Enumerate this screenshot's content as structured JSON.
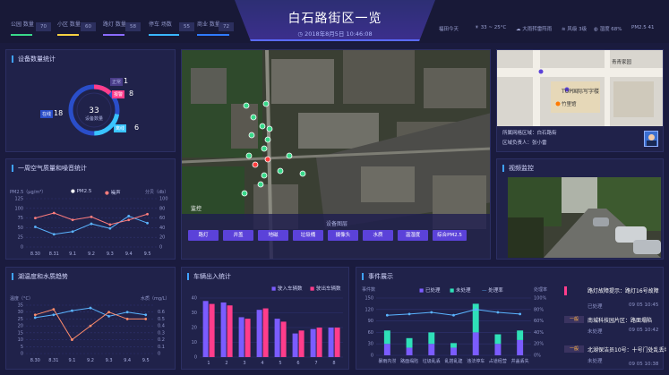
{
  "header": {
    "title": "白石路街区一览",
    "datetime": "2018年8月5日 10:46:08",
    "stats": [
      {
        "label": "公园\n数量",
        "value": "70",
        "color": "#39d98a"
      },
      {
        "label": "小区\n数量",
        "value": "60",
        "color": "#f5d142"
      },
      {
        "label": "路灯\n数量",
        "value": "58",
        "color": "#8a6bff"
      },
      {
        "label": "停车\n场数",
        "value": "55",
        "color": "#39b6ff"
      },
      {
        "label": "商业\n数量",
        "value": "72",
        "color": "#2f7bff"
      }
    ],
    "weather": {
      "label": "福田今天",
      "temp": "33 ~ 25°C",
      "condition": "大雨转雷阵雨",
      "wind": "风级 3级",
      "humidity": "湿度 68%",
      "pm": "PM2.5 41"
    }
  },
  "device_panel": {
    "title": "设备数量统计",
    "center_value": "33",
    "center_label": "设备数量",
    "labels": [
      {
        "text": "正常",
        "value": "1"
      },
      {
        "text": "报警",
        "value": "8"
      },
      {
        "text": "在线",
        "value": "18"
      },
      {
        "text": "离线",
        "value": "6"
      }
    ]
  },
  "air_panel": {
    "title": "一周空气质量和噪音统计",
    "left_unit": "PM2.5（μg/m³）",
    "right_unit": "分贝（db）",
    "legend": [
      "PM2.5",
      "噪声"
    ],
    "chart_data": {
      "type": "line",
      "categories": [
        "8.30",
        "8.31",
        "9.1",
        "9.2",
        "9.3",
        "9.4",
        "9.5"
      ],
      "series": [
        {
          "name": "PM2.5",
          "values": [
            52,
            33,
            40,
            60,
            48,
            80,
            62
          ],
          "color": "#5ab4ff"
        },
        {
          "name": "噪声",
          "values": [
            75,
            88,
            70,
            78,
            58,
            70,
            85
          ],
          "color": "#ff7d7d"
        }
      ],
      "ylim": [
        0,
        125
      ],
      "yticks": [
        0,
        25,
        50,
        75,
        100,
        125
      ],
      "y2ticks": [
        0,
        20,
        40,
        60,
        80,
        100
      ]
    }
  },
  "water_panel": {
    "title": "湖温度和水质趋势",
    "left_unit": "温度（°C）",
    "right_unit": "水质（mg/L）",
    "chart_data": {
      "type": "line",
      "categories": [
        "8.30",
        "8.31",
        "9.1",
        "9.2",
        "9.3",
        "9.4",
        "9.5"
      ],
      "series": [
        {
          "name": "温度",
          "values": [
            26,
            28,
            31,
            33,
            27,
            30,
            28
          ],
          "color": "#5ab4ff"
        },
        {
          "name": "水质",
          "values": [
            28,
            32,
            10,
            20,
            30,
            25,
            25
          ],
          "color": "#ff8c6b"
        }
      ],
      "ylim": [
        0,
        35
      ],
      "yticks": [
        0,
        5,
        10,
        15,
        20,
        25,
        30,
        35
      ],
      "y2ticks": [
        0,
        0.1,
        0.2,
        0.3,
        0.4,
        0.5,
        0.6
      ]
    }
  },
  "vehicle_panel": {
    "title": "车辆出入统计",
    "legend": [
      "驶入车辆数",
      "驶出车辆数"
    ],
    "chart_data": {
      "type": "bar",
      "categories": [
        "1",
        "2",
        "3",
        "4",
        "5",
        "6",
        "7",
        "8"
      ],
      "series": [
        {
          "name": "驶入车辆数",
          "values": [
            38,
            37,
            27,
            32,
            26,
            16,
            19,
            20
          ],
          "color": "#7b5cff"
        },
        {
          "name": "驶出车辆数",
          "values": [
            36,
            35,
            26,
            33,
            24,
            18,
            20,
            20
          ],
          "color": "#ff3d8b"
        }
      ],
      "ylim": [
        0,
        40
      ],
      "yticks": [
        0,
        10,
        20,
        30,
        40
      ]
    }
  },
  "event_panel": {
    "title": "事件展示",
    "left_unit": "事件数",
    "right_unit": "处理率",
    "legend": [
      "已处理",
      "未处理",
      "处理率"
    ],
    "chart_data": {
      "type": "bar",
      "categories": [
        "暴雨内涝",
        "路面塌陷",
        "垃圾乱丢",
        "乱搭乱建",
        "违法停车",
        "占道经营",
        "井盖丢失"
      ],
      "series": [
        {
          "name": "已处理",
          "values": [
            30,
            20,
            30,
            20,
            60,
            30,
            40
          ],
          "color": "#7b5cff"
        },
        {
          "name": "未处理",
          "values": [
            35,
            25,
            30,
            12,
            75,
            25,
            25
          ],
          "color": "#2fe0b8"
        },
        {
          "name": "处理率",
          "values": [
            70,
            72,
            75,
            70,
            80,
            75,
            72
          ],
          "color": "#5ab4ff"
        }
      ],
      "ylim": [
        0,
        150
      ],
      "yticks": [
        0,
        30,
        60,
        90,
        120,
        150
      ],
      "y2ticks": [
        "0%",
        "20%",
        "40%",
        "60%",
        "80%",
        "100%"
      ]
    }
  },
  "map": {
    "label": "监控",
    "layer_title": "设备图层",
    "buttons": [
      "路灯",
      "井盖",
      "地磁",
      "垃圾桶",
      "摄像头",
      "水质",
      "温湿度",
      "综合PM2.5"
    ]
  },
  "info_panel": {
    "title_label": "青青家园",
    "poi1": "TOP国际写字楼",
    "poi2": "竹里馆",
    "line1": "所属网格区域：白石路街",
    "line2": "区域负责人：张小雷"
  },
  "video_panel": {
    "title": "视频监控"
  },
  "news": [
    {
      "badge": "",
      "title": "路灯故障提示：路灯16号故障",
      "sub": "已处理",
      "time": "09 05 10:45"
    },
    {
      "badge": "一般",
      "title": "南城科技园片区：路面塌陷",
      "sub": "未处理",
      "time": "09 05 10:42"
    },
    {
      "badge": "一般",
      "title": "北湖保洁员10号：十号门处乱丢垃圾",
      "sub": "未处理",
      "time": "09 05 10:38"
    }
  ]
}
